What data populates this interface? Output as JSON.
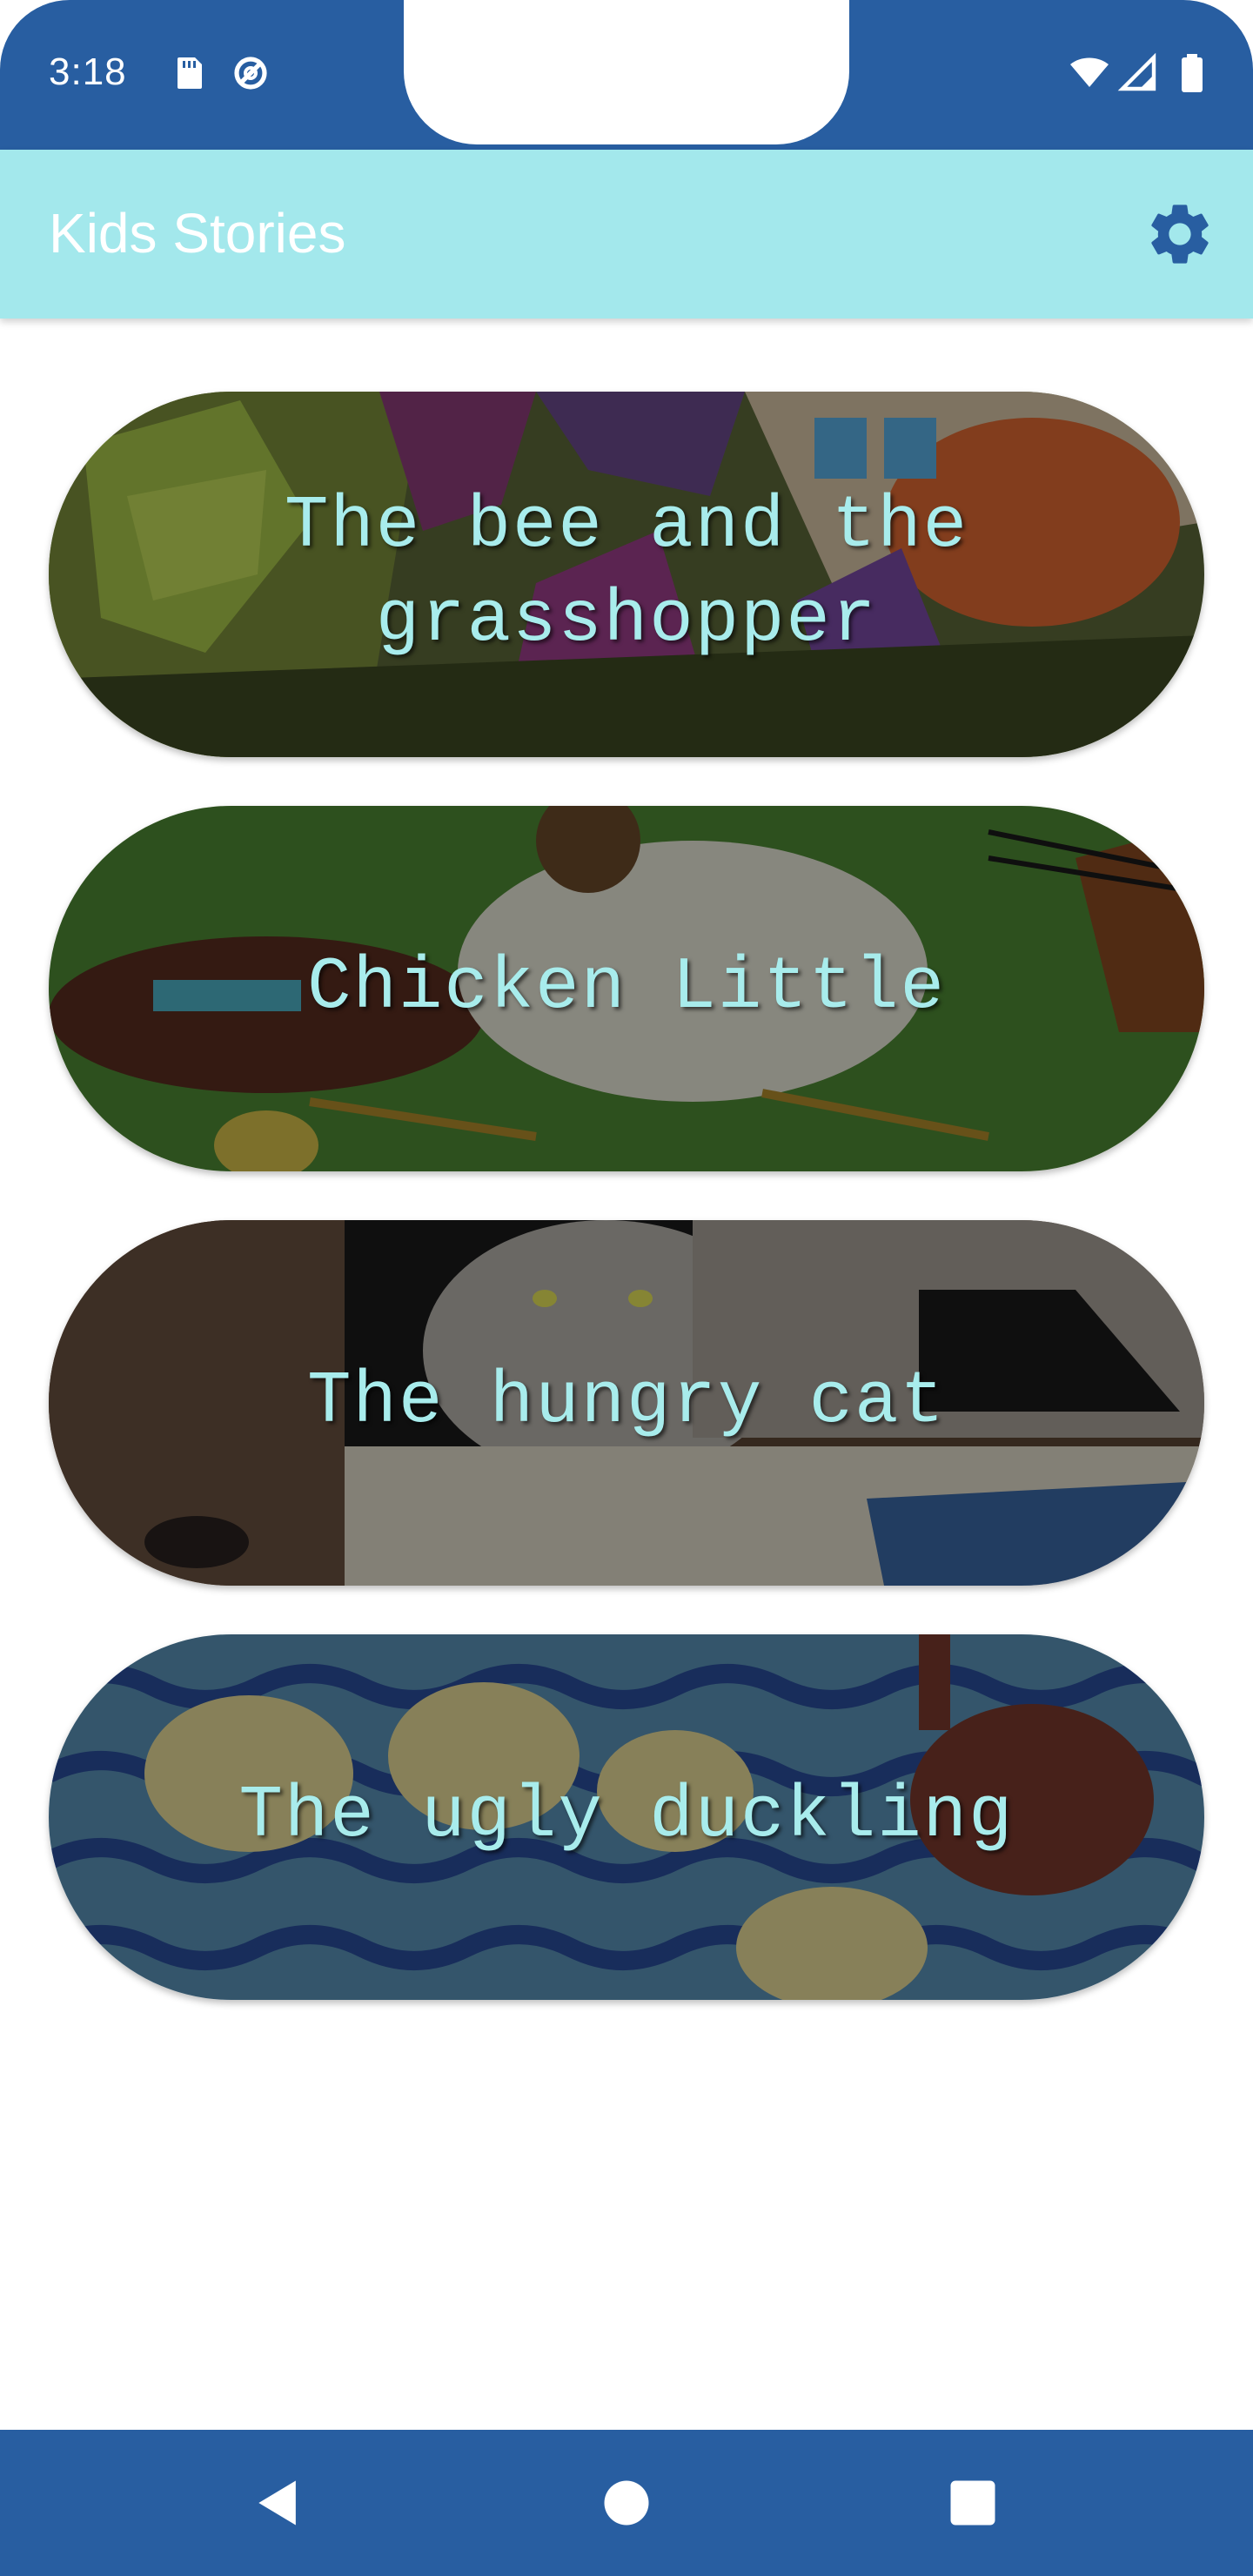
{
  "status_bar": {
    "time": "3:18",
    "left_icons": [
      "sd-card-icon",
      "data-saver-icon"
    ],
    "right_icons": [
      "wifi-icon",
      "signal-icon",
      "battery-icon"
    ]
  },
  "app_bar": {
    "title": "Kids Stories",
    "settings_icon": "gear-icon"
  },
  "stories": [
    {
      "title": "The bee and the grasshopper"
    },
    {
      "title": "Chicken Little"
    },
    {
      "title": "The hungry cat"
    },
    {
      "title": "The ugly duckling"
    }
  ],
  "nav_bar": {
    "buttons": [
      "back-icon",
      "home-icon",
      "recents-icon"
    ]
  },
  "colors": {
    "primary_dark": "#285ea1",
    "app_bar": "#a3e8ec",
    "card_title": "#a8ecec"
  }
}
